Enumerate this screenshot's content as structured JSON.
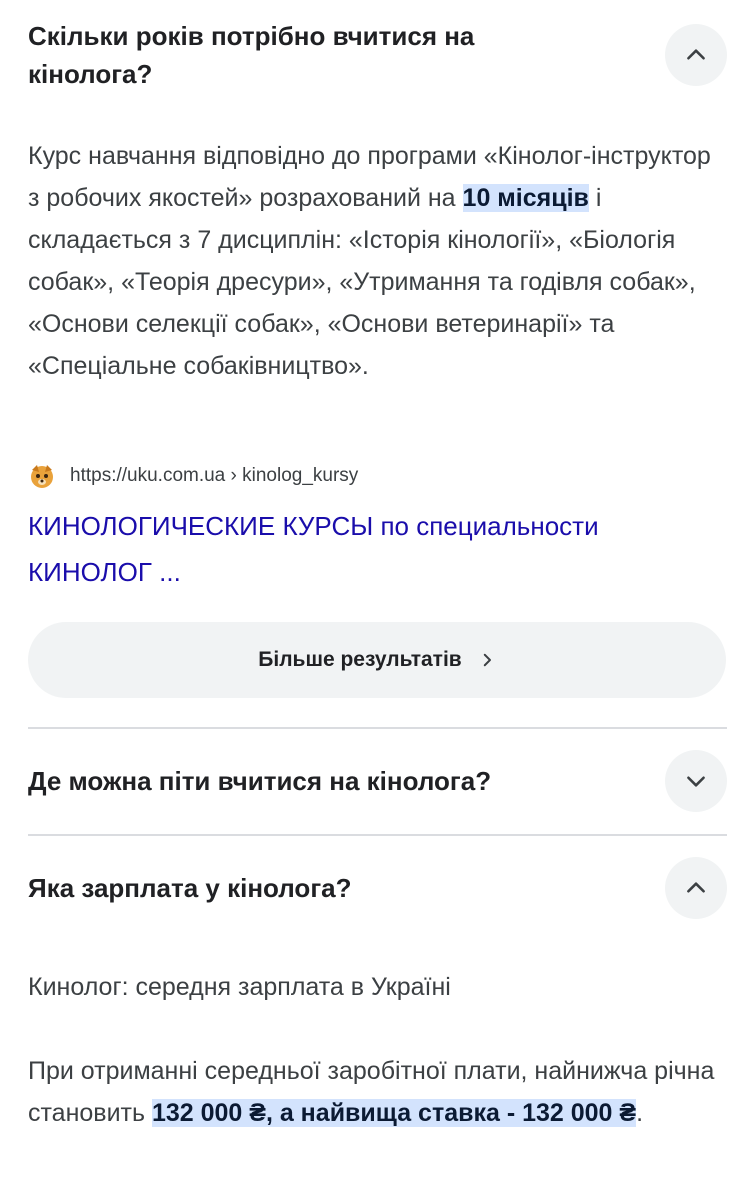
{
  "faq1": {
    "question": "Скільки років потрібно вчитися на кінолога?",
    "answer_before": "Курс навчання відповідно до програми «Кінолог-інструктор з робочих якостей» розрахований на ",
    "answer_highlight": "10 місяців",
    "answer_after": " і складається з 7 дисциплін: «Історія кінології», «Біологія собак», «Теорія дресури», «Утримання та годівля собак», «Основи селекції собак», «Основи ветеринарії» та «Спеціальне собаківництво».",
    "source_url": "https://uku.com.ua › kinolog_kursy",
    "source_title": "КИНОЛОГИЧЕСКИЕ КУРСЫ по специальности КИНОЛОГ ...",
    "icon": "chevron-up-icon"
  },
  "more_results": {
    "label": "Більше результатів",
    "icon": "chevron-right-icon"
  },
  "faq2": {
    "question": "Де можна піти вчитися на кінолога?",
    "icon": "chevron-down-icon"
  },
  "faq3": {
    "question": "Яка зарплата у кінолога?",
    "subtitle": "Кинолог: середня зарплата в Україні",
    "answer_before": "При отриманні середньої заробітної плати, найнижча річна становить ",
    "answer_highlight": "132 000 ₴, а найвища ставка - 132 000 ₴",
    "answer_after": ".",
    "icon": "chevron-up-icon"
  },
  "colors": {
    "link": "#1a0dab",
    "highlight": "#d3e3fd",
    "button_bg": "#f1f3f4",
    "divider": "#dadce0"
  }
}
